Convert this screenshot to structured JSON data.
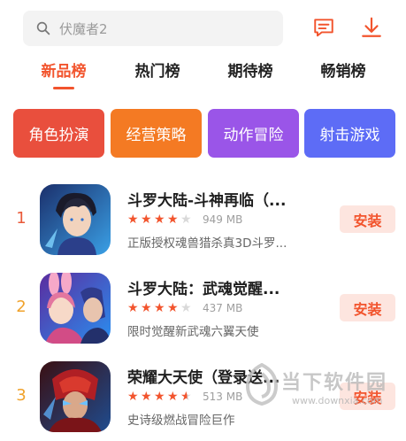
{
  "search": {
    "placeholder": "伏魔者2"
  },
  "icons": {
    "search": "search-icon",
    "message": "message-icon",
    "download": "download-icon"
  },
  "colors": {
    "accent": "#f2542d",
    "rank_red": "#e95a3a",
    "rank_orange": "#f0a22b",
    "star_on": "#f2542d",
    "star_off": "#d9d9d9"
  },
  "tabs": [
    {
      "label": "新品榜",
      "active": true
    },
    {
      "label": "热门榜",
      "active": false
    },
    {
      "label": "期待榜",
      "active": false
    },
    {
      "label": "畅销榜",
      "active": false
    }
  ],
  "categories": [
    {
      "label": "角色扮演",
      "color": "#e94f3d"
    },
    {
      "label": "经营策略",
      "color": "#f47a23"
    },
    {
      "label": "动作冒险",
      "color": "#9a55e8"
    },
    {
      "label": "射击游戏",
      "color": "#5d6cf6"
    }
  ],
  "apps": [
    {
      "rank": "1",
      "name": "斗罗大陆-斗神再临（...",
      "rating": 4,
      "size": "949 MB",
      "desc": "正版授权魂兽猎杀真3D斗罗...",
      "install": "安装"
    },
    {
      "rank": "2",
      "name": "斗罗大陆：武魂觉醒...",
      "rating": 4,
      "size": "437 MB",
      "desc": "限时觉醒新武魂六翼天使",
      "install": "安装"
    },
    {
      "rank": "3",
      "name": "荣耀大天使（登录送...",
      "rating": 4.5,
      "size": "513 MB",
      "desc": "史诗级燃战冒险巨作",
      "install": "安装"
    }
  ],
  "watermark": {
    "text": "当下软件园",
    "url": "www.downxia.com"
  }
}
